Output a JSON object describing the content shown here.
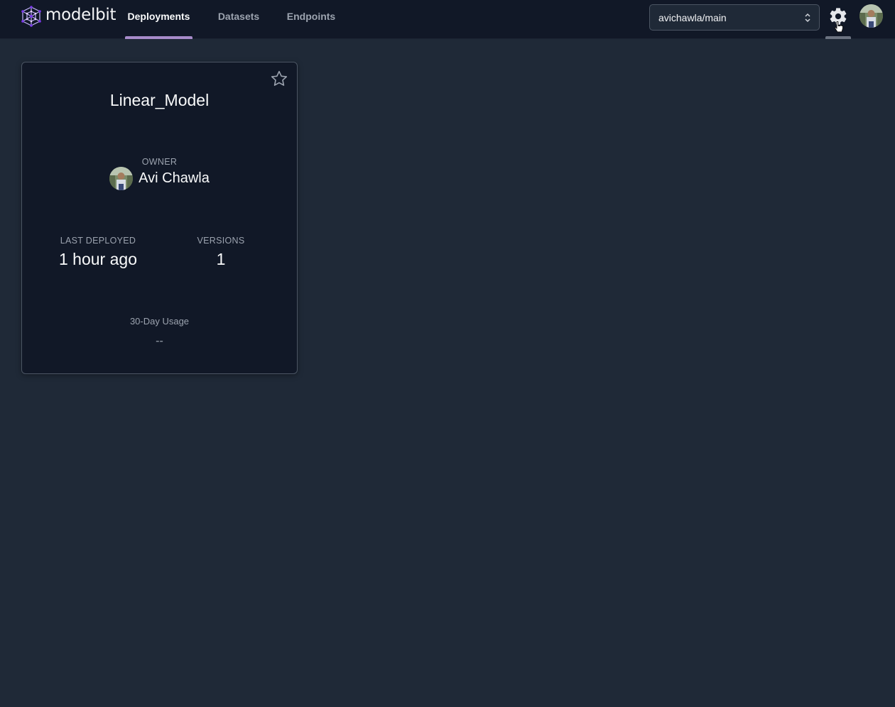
{
  "app": {
    "brand": "modelbit"
  },
  "nav": {
    "tabs": [
      {
        "label": "Deployments",
        "active": true
      },
      {
        "label": "Datasets",
        "active": false
      },
      {
        "label": "Endpoints",
        "active": false
      }
    ]
  },
  "header": {
    "branch_select_value": "avichawla/main",
    "settings_icon": "gear-icon",
    "avatar": "user-avatar"
  },
  "deployment_card": {
    "name": "Linear_Model",
    "owner_label": "OWNER",
    "owner_name": "Avi Chawla",
    "last_deployed_label": "LAST DEPLOYED",
    "last_deployed_value": "1 hour ago",
    "versions_label": "VERSIONS",
    "versions_value": "1",
    "usage_label": "30-Day Usage",
    "usage_value": "--",
    "favorite_icon": "star-icon"
  },
  "colors": {
    "page_bg": "#1f2937",
    "topbar_bg": "#111827",
    "card_bg": "#111827",
    "active_tab_accent": "#a78bca",
    "brand_purple": "#8b5cf6"
  }
}
